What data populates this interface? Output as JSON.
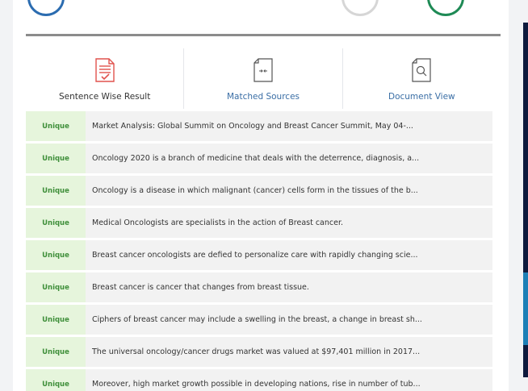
{
  "colors": {
    "unique_badge_bg": "#e6f5dc",
    "unique_badge_text": "#3f8f3a",
    "divider": "#8c8c8c",
    "tab_link": "#3a6ea5",
    "side_panel": "#0e1a3d"
  },
  "tabs": [
    {
      "label": "Sentence Wise Result",
      "icon": "report-check-icon",
      "active": true
    },
    {
      "label": "Matched Sources",
      "icon": "compare-doc-icon",
      "active": false
    },
    {
      "label": "Document View",
      "icon": "search-doc-icon",
      "active": false
    }
  ],
  "results": [
    {
      "status": "Unique",
      "text": "Market Analysis: Global Summit on Oncology and Breast Cancer Summit, May 04-..."
    },
    {
      "status": "Unique",
      "text": "Oncology 2020 is a branch of medicine that deals with the deterrence, diagnosis, a..."
    },
    {
      "status": "Unique",
      "text": "Oncology is a disease in which malignant (cancer) cells form in the tissues of the b..."
    },
    {
      "status": "Unique",
      "text": "Medical Oncologists are specialists in the action of Breast cancer."
    },
    {
      "status": "Unique",
      "text": "Breast cancer oncologists are defied to personalize care with rapidly changing scie..."
    },
    {
      "status": "Unique",
      "text": "Breast cancer is cancer that changes from breast tissue."
    },
    {
      "status": "Unique",
      "text": "Ciphers of breast cancer may include a swelling in the breast, a change in breast sh..."
    },
    {
      "status": "Unique",
      "text": "The universal oncology/cancer drugs market was valued at $97,401 million in 2017..."
    },
    {
      "status": "Unique",
      "text": "Moreover, high market growth possible in developing nations, rise in number of tub..."
    }
  ]
}
